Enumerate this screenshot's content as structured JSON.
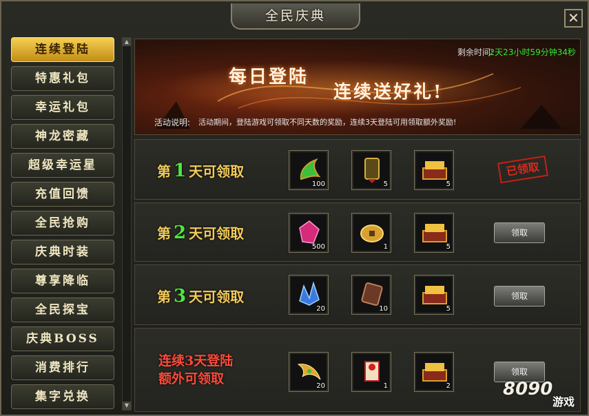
{
  "window": {
    "title": "全民庆典",
    "close_symbol": "✕"
  },
  "sidebar": {
    "items": [
      {
        "label": "连续登陆",
        "active": true
      },
      {
        "label": "特惠礼包"
      },
      {
        "label": "幸运礼包"
      },
      {
        "label": "神龙密藏"
      },
      {
        "label": "超级幸运星"
      },
      {
        "label": "充值回馈"
      },
      {
        "label": "全民抢购"
      },
      {
        "label": "庆典时装"
      },
      {
        "label": "尊享降临"
      },
      {
        "label": "全民探宝"
      },
      {
        "label": "庆典BOSS"
      },
      {
        "label": "消费排行"
      },
      {
        "label": "集字兑换"
      }
    ]
  },
  "banner": {
    "countdown_label": "剩余时间:",
    "countdown_value": "2天23小时59分钟34秒",
    "title_line1": "每日登陆",
    "title_line2": "连续送好礼!",
    "desc_label": "活动说明:",
    "desc_text": "活动期间，登陆游戏可领取不同天数的奖励，连续3天登陆可用领取额外奖励!"
  },
  "rows": [
    {
      "prefix": "第",
      "day": "1",
      "suffix": "天可领取",
      "items": [
        {
          "icon": "jade-dragon-icon",
          "count": "100"
        },
        {
          "icon": "bronze-token-icon",
          "count": "5"
        },
        {
          "icon": "gold-chest-icon",
          "count": "5"
        }
      ],
      "status": "已领取"
    },
    {
      "prefix": "第",
      "day": "2",
      "suffix": "天可领取",
      "items": [
        {
          "icon": "pink-gem-icon",
          "count": "500"
        },
        {
          "icon": "gold-coin-icon",
          "count": "1"
        },
        {
          "icon": "gold-chest-icon",
          "count": "5"
        }
      ],
      "button": "领取"
    },
    {
      "prefix": "第",
      "day": "3",
      "suffix": "天可领取",
      "items": [
        {
          "icon": "blue-crystal-icon",
          "count": "20"
        },
        {
          "icon": "rune-stone-icon",
          "count": "10"
        },
        {
          "icon": "gold-chest-icon",
          "count": "5"
        }
      ],
      "button": "领取"
    },
    {
      "bonus_line1": "连续3天登陆",
      "bonus_line2": "额外可领取",
      "items": [
        {
          "icon": "golden-wing-icon",
          "count": "20"
        },
        {
          "icon": "scroll-icon",
          "count": "1"
        },
        {
          "icon": "gold-chest-icon",
          "count": "2"
        }
      ],
      "button": "领取"
    }
  ],
  "watermark": {
    "text": "8090",
    "sub": "游戏"
  },
  "colors": {
    "accent_gold": "#f3cb5a",
    "day_green": "#4fe63d",
    "countdown_green": "#35e835",
    "bonus_red": "#ff4a3a",
    "stamp_red": "#d62a1d"
  }
}
